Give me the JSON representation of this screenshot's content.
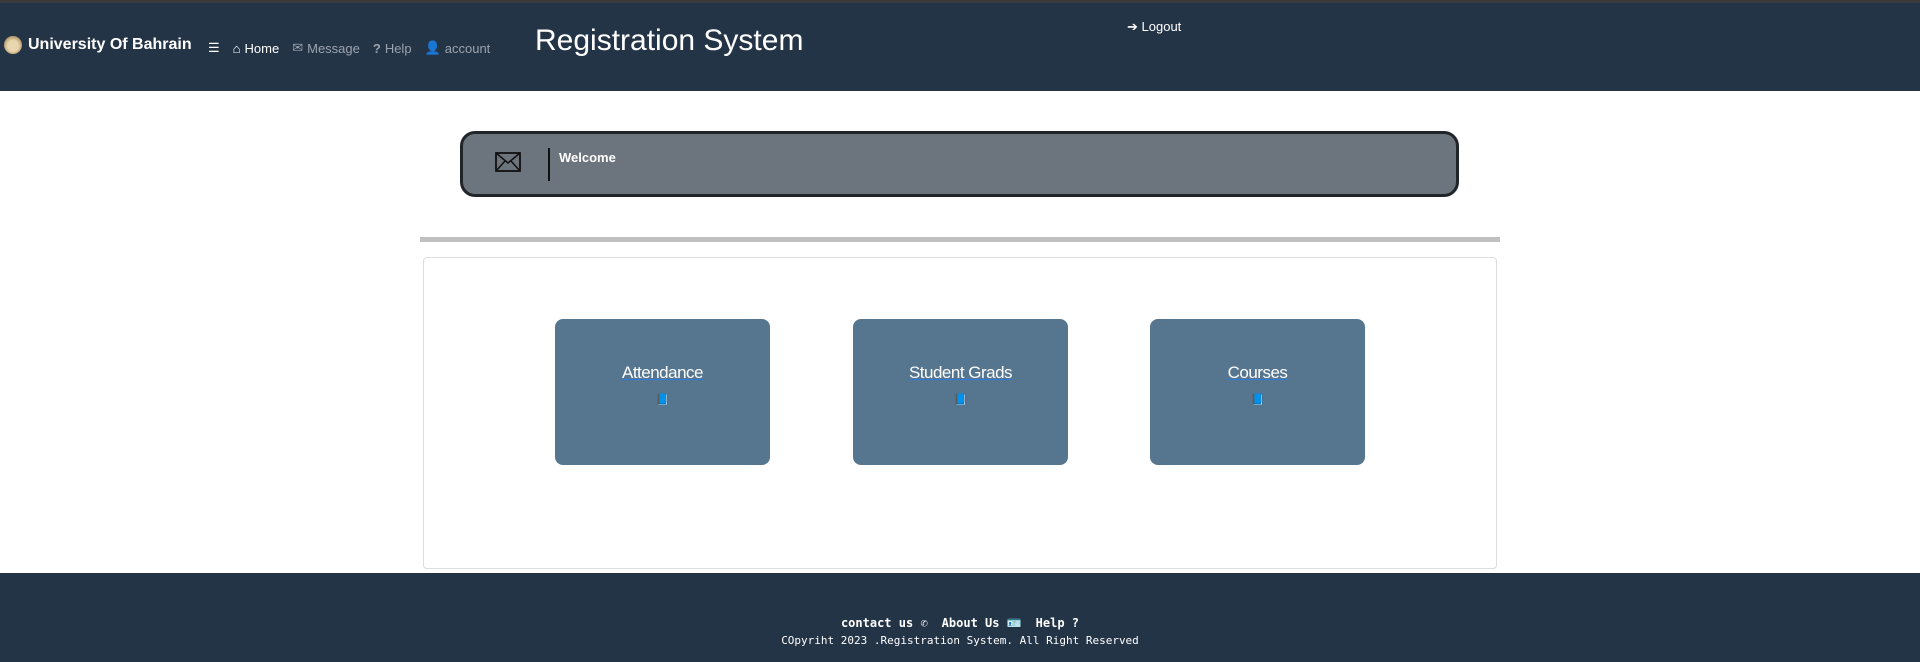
{
  "nav": {
    "brand": "University Of Bahrain",
    "items": [
      {
        "label": "Home"
      },
      {
        "label": "Message"
      },
      {
        "label": "Help"
      },
      {
        "label": "account"
      }
    ],
    "title": "Registration System",
    "logout": "Logout"
  },
  "welcome": {
    "text": "Welcome"
  },
  "tiles": [
    {
      "label": "Attendance"
    },
    {
      "label": "Student Grads"
    },
    {
      "label": "Courses"
    }
  ],
  "footer": {
    "contact": "contact us",
    "about": "About Us",
    "help": "Help",
    "copyright": "COpyriht 2023 .Registration System. All Right Reserved"
  },
  "colors": {
    "nav": "#243447",
    "tile": "#56758f",
    "banner": "#6c757d"
  }
}
